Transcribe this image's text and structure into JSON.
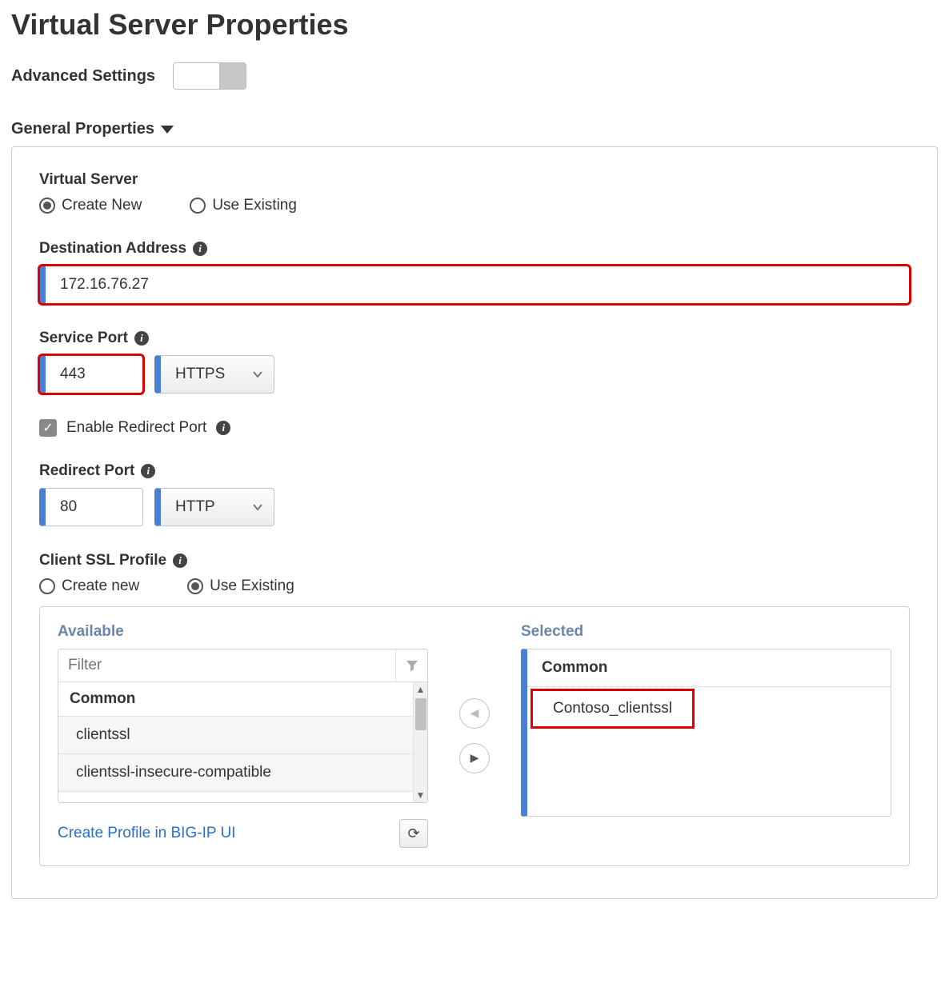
{
  "title": "Virtual Server Properties",
  "advanced_settings": {
    "label": "Advanced Settings",
    "enabled": false
  },
  "section": {
    "title": "General Properties"
  },
  "virtual_server": {
    "label": "Virtual Server",
    "options": {
      "create_new": "Create New",
      "use_existing": "Use Existing"
    },
    "selected": "create_new"
  },
  "destination_address": {
    "label": "Destination Address",
    "value": "172.16.76.27"
  },
  "service_port": {
    "label": "Service Port",
    "value": "443",
    "protocol": "HTTPS"
  },
  "enable_redirect_port": {
    "label": "Enable Redirect Port",
    "checked": true
  },
  "redirect_port": {
    "label": "Redirect Port",
    "value": "80",
    "protocol": "HTTP"
  },
  "client_ssl_profile": {
    "label": "Client SSL Profile",
    "options": {
      "create_new": "Create new",
      "use_existing": "Use Existing"
    },
    "selected": "use_existing",
    "available": {
      "title": "Available",
      "filter_placeholder": "Filter",
      "group": "Common",
      "items": [
        "clientssl",
        "clientssl-insecure-compatible"
      ]
    },
    "selected_list": {
      "title": "Selected",
      "group": "Common",
      "items": [
        "Contoso_clientssl"
      ]
    },
    "create_link": "Create Profile in BIG-IP UI"
  }
}
